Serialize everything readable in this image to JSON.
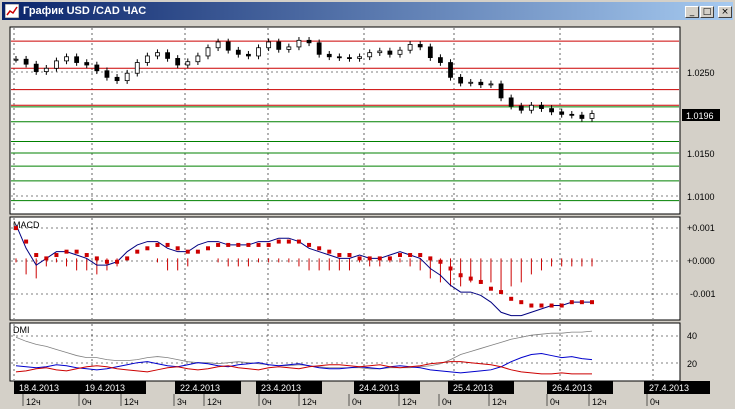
{
  "window": {
    "title": "График USD /CAD  ЧАС",
    "minimize_glyph": "_",
    "maximize_glyph": "□",
    "close_glyph": "×"
  },
  "price_panel": {
    "axis_labels": [
      "1.0250",
      "1.0150",
      "1.0100"
    ],
    "current_price": "1.0196"
  },
  "macd_panel": {
    "name": "MACD",
    "axis_labels": [
      "+0.001",
      "+0.000",
      "-0.001"
    ]
  },
  "dmi_panel": {
    "name": "DMI",
    "axis_labels": [
      "40",
      "20"
    ]
  },
  "time_axis": {
    "dates": [
      "18.4.2013",
      "19.4.2013",
      "22.4.2013",
      "23.4.2013",
      "24.4.2013",
      "25.4.2013",
      "26.4.2013",
      "27.4.2013"
    ],
    "hours": [
      "12ч",
      "0ч",
      "12ч",
      "3ч",
      "12ч",
      "0ч",
      "12ч",
      "0ч",
      "12ч",
      "0ч",
      "12ч",
      "0ч",
      "12ч",
      "0ч",
      "12ч",
      "0ч"
    ]
  },
  "colors": {
    "plot_bg": "#ffffff",
    "resistance_line": "#cc0000",
    "support_line": "#008000",
    "candle": "#000000",
    "macd_signal": "#cc0000",
    "macd_line": "#000080",
    "dmi_adx": "#808080",
    "dmi_plus": "#0000cc",
    "dmi_minus": "#cc0000",
    "date_box": "#000000"
  },
  "chart_data": {
    "type": "line",
    "price_levels_red": [
      1.0284,
      1.0251,
      1.0225,
      1.0206
    ],
    "price_levels_green": [
      1.0204,
      1.0186,
      1.0162,
      1.0148,
      1.0132,
      1.0114,
      1.009
    ],
    "close_series": [
      1.0262,
      1.0256,
      1.0247,
      1.0251,
      1.026,
      1.0265,
      1.0258,
      1.0255,
      1.0248,
      1.024,
      1.0236,
      1.0245,
      1.0258,
      1.0266,
      1.027,
      1.0263,
      1.0255,
      1.0259,
      1.0266,
      1.0276,
      1.0283,
      1.0273,
      1.0268,
      1.0266,
      1.0276,
      1.0283,
      1.0274,
      1.0277,
      1.0285,
      1.0282,
      1.0268,
      1.0265,
      1.0264,
      1.0263,
      1.0265,
      1.027,
      1.0272,
      1.0268,
      1.0273,
      1.028,
      1.0277,
      1.0264,
      1.0258,
      1.024,
      1.0233,
      1.0234,
      1.0231,
      1.0232,
      1.0215,
      1.0205,
      1.02,
      1.0206,
      1.0202,
      1.0198,
      1.0195,
      1.0194,
      1.019,
      1.0196
    ],
    "macd_signal": [
      0.0009,
      0.0005,
      0.0001,
      0.0,
      0.0001,
      0.0002,
      0.0002,
      0.0001,
      0.0,
      -0.0001,
      -0.0001,
      0.0,
      0.0002,
      0.0003,
      0.0004,
      0.0004,
      0.0003,
      0.0002,
      0.0002,
      0.0003,
      0.0004,
      0.0004,
      0.0004,
      0.0004,
      0.0004,
      0.0004,
      0.0005,
      0.0005,
      0.0005,
      0.0004,
      0.0003,
      0.0002,
      0.0001,
      0.0001,
      0.0,
      0.0,
      0.0,
      0.0,
      0.0001,
      0.0001,
      0.0001,
      0.0,
      -0.0001,
      -0.0003,
      -0.0005,
      -0.0006,
      -0.0007,
      -0.0009,
      -0.001,
      -0.0012,
      -0.0013,
      -0.0014,
      -0.0014,
      -0.0014,
      -0.0014,
      -0.0013,
      -0.0013,
      -0.0013
    ],
    "macd_line": [
      0.001,
      0.0003,
      -0.0002,
      0.0,
      0.0002,
      0.0002,
      0.0001,
      0.0,
      -0.0002,
      -0.0002,
      -0.0001,
      0.0002,
      0.0004,
      0.0005,
      0.0005,
      0.0003,
      0.0002,
      0.0002,
      0.0004,
      0.0005,
      0.0005,
      0.0004,
      0.0004,
      0.0004,
      0.0005,
      0.0005,
      0.0006,
      0.0006,
      0.0005,
      0.0003,
      0.0002,
      0.0001,
      0.0,
      0.0,
      0.0001,
      0.0,
      0.0,
      0.0001,
      0.0002,
      0.0001,
      0.0,
      -0.0003,
      -0.0005,
      -0.0008,
      -0.001,
      -0.001,
      -0.0011,
      -0.0013,
      -0.0016,
      -0.0017,
      -0.0017,
      -0.0016,
      -0.0015,
      -0.0014,
      -0.0014,
      -0.0013,
      -0.0013,
      -0.0013
    ],
    "dmi_adx": [
      42,
      38,
      35,
      33,
      30,
      27,
      24,
      22,
      22,
      20,
      19,
      19,
      20,
      22,
      23,
      22,
      20,
      18,
      17,
      17,
      16,
      17,
      18,
      17,
      16,
      15,
      14,
      14,
      15,
      14,
      13,
      12,
      12,
      12,
      12,
      11,
      11,
      12,
      12,
      12,
      13,
      14,
      16,
      20,
      25,
      28,
      31,
      34,
      37,
      40,
      42,
      44,
      45,
      46,
      46,
      47,
      47,
      48
    ],
    "dmi_plus": [
      14,
      13,
      12,
      13,
      15,
      14,
      12,
      11,
      10,
      11,
      13,
      15,
      17,
      18,
      16,
      14,
      13,
      15,
      17,
      16,
      14,
      13,
      15,
      16,
      17,
      15,
      14,
      15,
      16,
      14,
      12,
      11,
      11,
      12,
      13,
      12,
      11,
      13,
      14,
      13,
      12,
      10,
      9,
      8,
      7,
      8,
      9,
      10,
      13,
      18,
      22,
      25,
      26,
      24,
      22,
      23,
      21,
      20
    ],
    "dmi_minus": [
      8,
      9,
      11,
      12,
      10,
      9,
      11,
      13,
      14,
      13,
      11,
      10,
      9,
      8,
      10,
      12,
      13,
      11,
      10,
      11,
      13,
      14,
      12,
      11,
      10,
      12,
      13,
      12,
      11,
      13,
      14,
      15,
      15,
      14,
      13,
      14,
      15,
      13,
      12,
      13,
      14,
      16,
      17,
      18,
      18,
      17,
      16,
      15,
      13,
      10,
      8,
      7,
      6,
      6,
      7,
      6,
      6,
      6
    ],
    "price_ylim": [
      1.0075,
      1.03
    ],
    "macd_ylim": [
      -0.0018,
      0.0012
    ],
    "dmi_ylim": [
      0,
      55
    ]
  }
}
